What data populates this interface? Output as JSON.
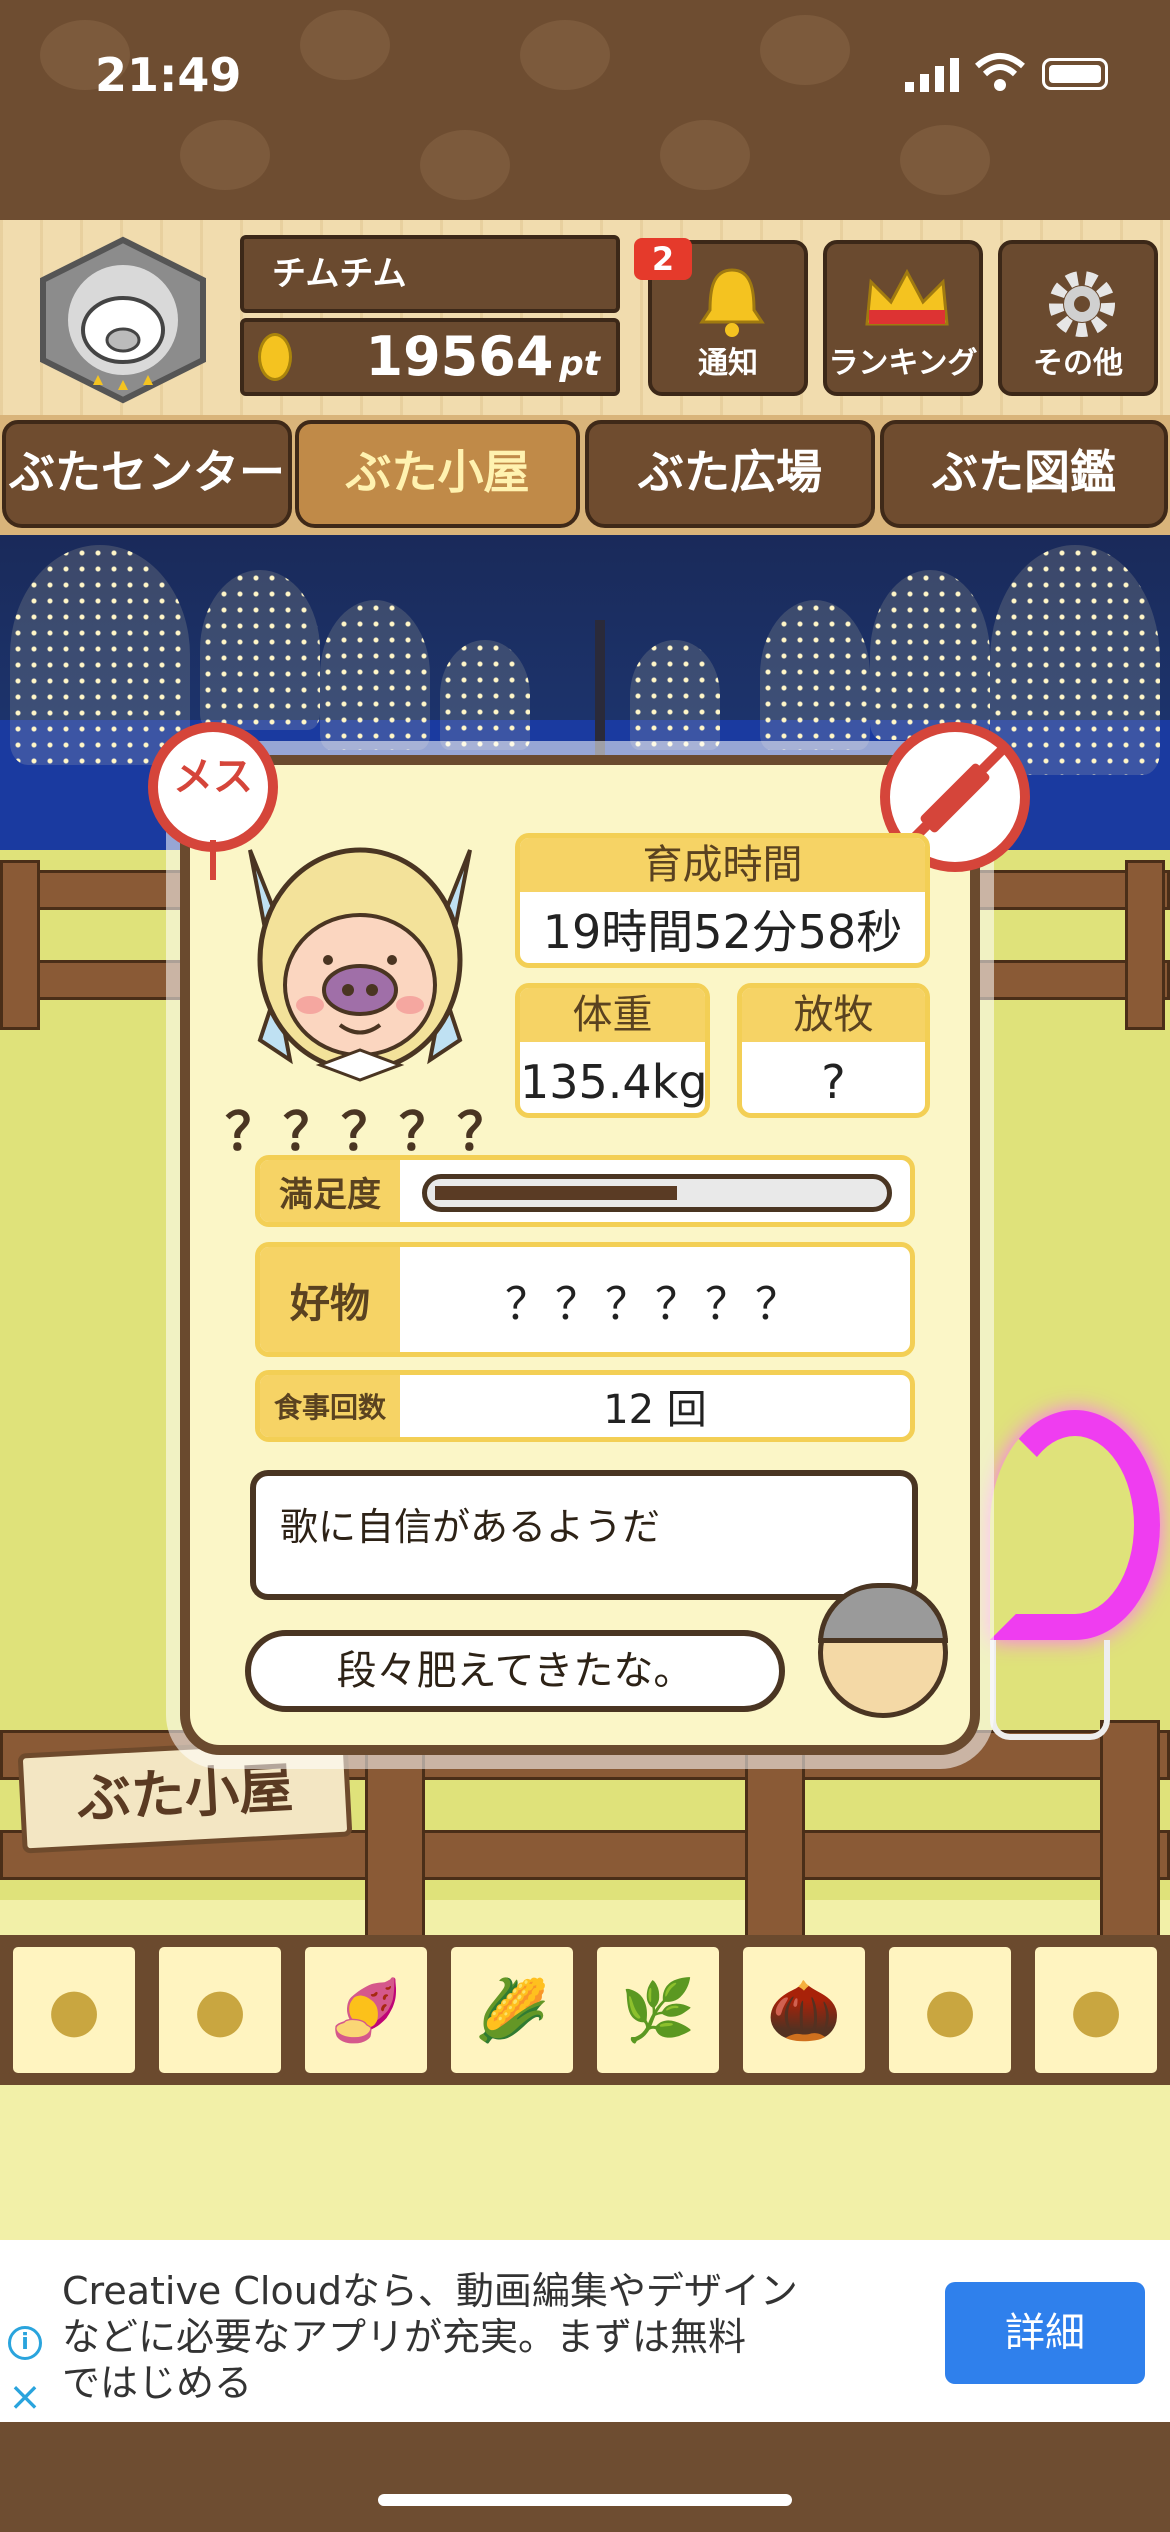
{
  "status": {
    "time": "21:49"
  },
  "header": {
    "player_name": "チムチム",
    "points": "19564",
    "points_unit": "pt",
    "notification_count": "2",
    "buttons": {
      "notice": "通知",
      "ranking": "ランキング",
      "other": "その他"
    }
  },
  "tabs": [
    {
      "label": "ぶたセンター",
      "active": false
    },
    {
      "label": "ぶた小屋",
      "active": true
    },
    {
      "label": "ぶた広場",
      "active": false
    },
    {
      "label": "ぶた図鑑",
      "active": false
    }
  ],
  "pig": {
    "gender_label": "メス",
    "name": "？？？？？",
    "growth_time_label": "育成時間",
    "growth_time": "19時間52分58秒",
    "weight_label": "体重",
    "weight": "135.4kg",
    "release_label": "放牧",
    "release": "?",
    "satisfaction_label": "満足度",
    "satisfaction": 0.55,
    "favorite_label": "好物",
    "favorite": "？？？？？？",
    "meals_label": "食事回数",
    "meals": "12 回",
    "trait_text": "歌に自信があるようだ",
    "farmer_comment": "段々肥えてきたな。"
  },
  "scene": {
    "sign": "ぶた小屋"
  },
  "foods": [
    {
      "icon": "soybean-pile-icon",
      "glyph": "●"
    },
    {
      "icon": "mixed-bean-pile-icon",
      "glyph": "●"
    },
    {
      "icon": "sweet-potato-icon",
      "glyph": "🍠"
    },
    {
      "icon": "corn-icon",
      "glyph": "🌽"
    },
    {
      "icon": "ginkgo-nut-icon",
      "glyph": "🌿"
    },
    {
      "icon": "acorn-icon",
      "glyph": "🌰"
    },
    {
      "icon": "bean-plate-icon",
      "glyph": "●"
    },
    {
      "icon": "truffle-plate-icon",
      "glyph": "●"
    }
  ],
  "ad": {
    "text_line1": "Creative Cloudなら、動画編集やデザイン",
    "text_line2": "などに必要なアプリが充実。まずは無料",
    "text_line3": "ではじめる",
    "button": "詳細"
  },
  "colors": {
    "brand_brown": "#6a4a2e",
    "card_yellow": "#f6d365",
    "alert_red": "#d5453a",
    "ad_blue": "#2f80ec"
  }
}
